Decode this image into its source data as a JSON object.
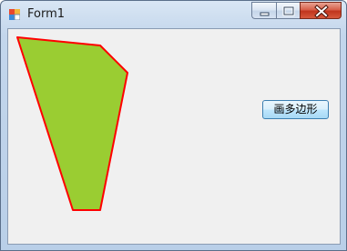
{
  "window": {
    "title": "Form1",
    "icon": "form-app-icon",
    "controls": [
      "minimize-icon",
      "maximize-icon",
      "close-icon"
    ]
  },
  "canvas": {
    "shape": "polygon",
    "fill_color": "#9ACD32",
    "stroke_color": "#FF0000"
  },
  "buttons": {
    "draw_polygon_label": "画多边形"
  }
}
